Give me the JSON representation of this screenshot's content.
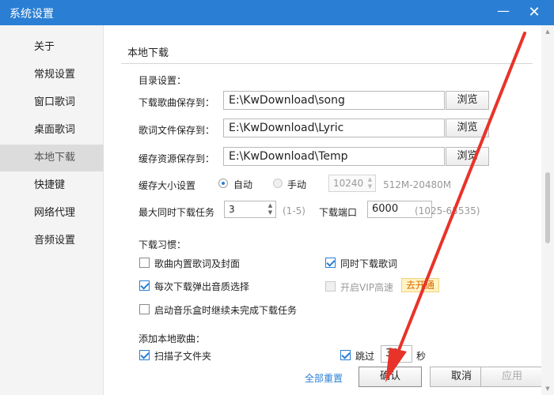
{
  "window": {
    "title": "系统设置",
    "minimize_glyph": "—",
    "close_glyph": "✕"
  },
  "sidebar": {
    "items": [
      {
        "label": "关于",
        "active": false
      },
      {
        "label": "常规设置",
        "active": false
      },
      {
        "label": "窗口歌词",
        "active": false
      },
      {
        "label": "桌面歌词",
        "active": false
      },
      {
        "label": "本地下载",
        "active": true
      },
      {
        "label": "快捷键",
        "active": false
      },
      {
        "label": "网络代理",
        "active": false
      },
      {
        "label": "音频设置",
        "active": false
      }
    ]
  },
  "section": {
    "title": "本地下载"
  },
  "directory": {
    "heading": "目录设置：",
    "rows": [
      {
        "label": "下载歌曲保存到：",
        "value": "E:\\KwDownload\\song",
        "button": "浏览"
      },
      {
        "label": "歌词文件保存到：",
        "value": "E:\\KwDownload\\Lyric",
        "button": "浏览"
      },
      {
        "label": "缓存资源保存到：",
        "value": "E:\\KwDownload\\Temp",
        "button": "浏览"
      }
    ]
  },
  "cache": {
    "label": "缓存大小设置",
    "auto_label": "自动",
    "manual_label": "手动",
    "size_value": "10240",
    "range_hint": "512M-20480M",
    "selected": "auto"
  },
  "tasks": {
    "label": "最大同时下载任务",
    "value": "3",
    "range_hint": "(1-5)",
    "port_label": "下载端口",
    "port_value": "6000",
    "port_range": "(1025-65535)"
  },
  "habits": {
    "heading": "下载习惯：",
    "options": [
      {
        "label": "歌曲内置歌词及封面",
        "checked": false,
        "enabled": true
      },
      {
        "label": "同时下载歌词",
        "checked": true,
        "enabled": true
      },
      {
        "label": "每次下载弹出音质选择",
        "checked": true,
        "enabled": true
      },
      {
        "label": "开启VIP高速",
        "checked": false,
        "enabled": false
      },
      {
        "label": "启动音乐盒时继续未完成下载任务",
        "checked": false,
        "enabled": true
      }
    ],
    "vip_badge": "去开通"
  },
  "local_songs": {
    "heading": "添加本地歌曲：",
    "scan_label": "扫描子文件夹",
    "scan_checked": true,
    "skip_label": "跳过",
    "skip_checked": true,
    "skip_value": "30",
    "skip_unit": "秒"
  },
  "footer": {
    "reset_label": "全部重置",
    "ok_label": "确认",
    "cancel_label": "取消",
    "apply_label": "应用"
  },
  "colors": {
    "accent": "#2a7fd4",
    "annotation_arrow": "#e8332a"
  }
}
